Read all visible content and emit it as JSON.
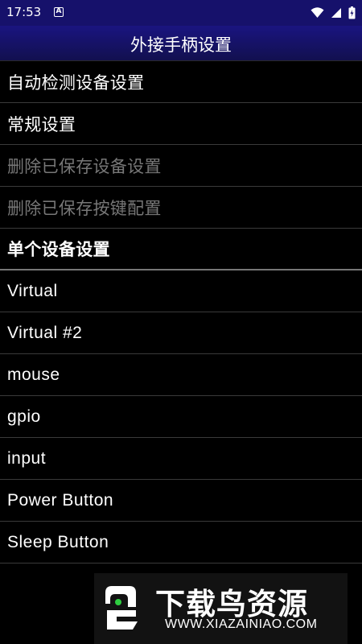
{
  "status_bar": {
    "time": "17:53",
    "notification_letter": "A"
  },
  "header": {
    "title": "外接手柄设置"
  },
  "settings": [
    {
      "label": "自动检测设备设置",
      "enabled": true
    },
    {
      "label": "常规设置",
      "enabled": true
    },
    {
      "label": "删除已保存设备设置",
      "enabled": false
    },
    {
      "label": "删除已保存按键配置",
      "enabled": false
    }
  ],
  "section_header": "单个设备设置",
  "devices": [
    {
      "label": "Virtual"
    },
    {
      "label": "Virtual #2"
    },
    {
      "label": "mouse"
    },
    {
      "label": "gpio"
    },
    {
      "label": "input"
    },
    {
      "label": "Power Button"
    },
    {
      "label": "Sleep Button"
    }
  ],
  "watermark": {
    "title": "下载鸟资源",
    "url": "WWW.XIAZAINIAO.COM"
  },
  "colors": {
    "status_bar": "#16116b",
    "title_bar": "#1a1480",
    "background": "#000000",
    "disabled_text": "#777777"
  }
}
